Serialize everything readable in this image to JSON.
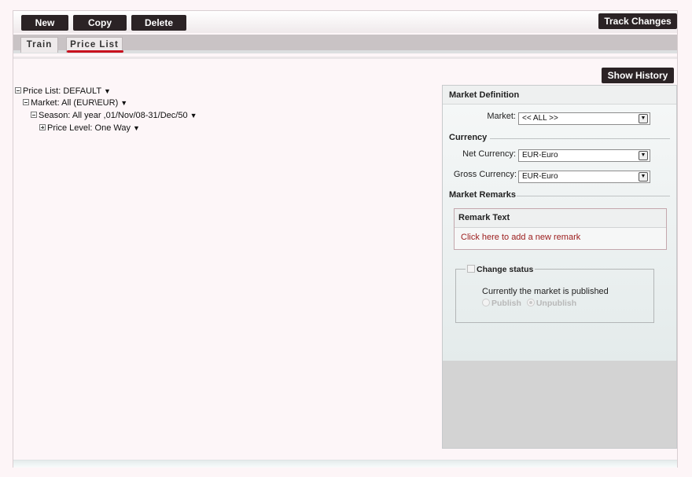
{
  "toolbar": {
    "new_label": "New",
    "copy_label": "Copy",
    "delete_label": "Delete",
    "track_changes_label": "Track Changes"
  },
  "tabs": [
    {
      "label": "Train"
    },
    {
      "label": "Price List"
    }
  ],
  "show_history_label": "Show History",
  "tree": {
    "price_list": "Price List: DEFAULT",
    "market": "Market: All (EUR\\EUR)",
    "season": "Season: All year ,01/Nov/08-31/Dec/50",
    "price_level": "Price Level: One Way",
    "caret": "▼"
  },
  "panel": {
    "title": "Market Definition",
    "market_label": "Market:",
    "market_value": "<< ALL >>",
    "currency_section": "Currency",
    "net_currency_label": "Net Currency:",
    "net_currency_value": "EUR-Euro",
    "gross_currency_label": "Gross Currency:",
    "gross_currency_value": "EUR-Euro",
    "remarks_section": "Market Remarks",
    "remark_header": "Remark Text",
    "add_remark_link": "Click here to add a new remark",
    "change_status_legend": "Change status",
    "status_text": "Currently the market is published",
    "publish_label": "Publish",
    "unpublish_label": "Unpublish"
  }
}
